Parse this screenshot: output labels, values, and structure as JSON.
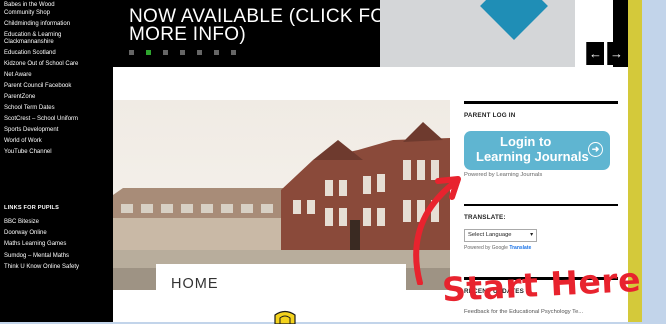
{
  "sidebar": {
    "links_top": [
      "Babes in the Wood",
      "Community Shop",
      "Childminding information",
      "Education & Learning",
      "Clackmannanshire",
      "Education Scotland",
      "Kidzone Out of School Care",
      "Net Aware",
      "Parent Council Facebook",
      "ParentZone",
      "School Term Dates",
      "ScotCrest – School Uniform",
      "Sports Development",
      "World of Work",
      "YouTube Channel"
    ],
    "pupils_heading": "LINKS FOR PUPILS",
    "links_pupils": [
      "BBC Bitesize",
      "Doorway Online",
      "Maths Learning Games",
      "Sumdog – Mental Maths",
      "Think U Know Online Safety"
    ]
  },
  "hero": {
    "caption_line1": "NOW AVAILABLE (CLICK FOR",
    "caption_line2": "MORE INFO)",
    "prev_icon": "←",
    "next_icon": "→"
  },
  "main": {
    "page_title": "HOME"
  },
  "widgets": {
    "parent_login_title": "PARENT LOG IN",
    "login_line1": "Login to",
    "login_line2": "Learning Journals",
    "login_go_icon": "➜",
    "powered_by": "Powered by Learning Journals",
    "translate_title": "TRANSLATE:",
    "select_value": "Select Language",
    "select_chevron": "▾",
    "google_powered": "Powered by Google",
    "google_translate": "Translate",
    "recent_updates_title": "RECENT UPDATES",
    "recent_item": "Feedback for the Educational Psychology Te..."
  },
  "annotation": {
    "text": "Start Here",
    "color": "#e8232e"
  }
}
